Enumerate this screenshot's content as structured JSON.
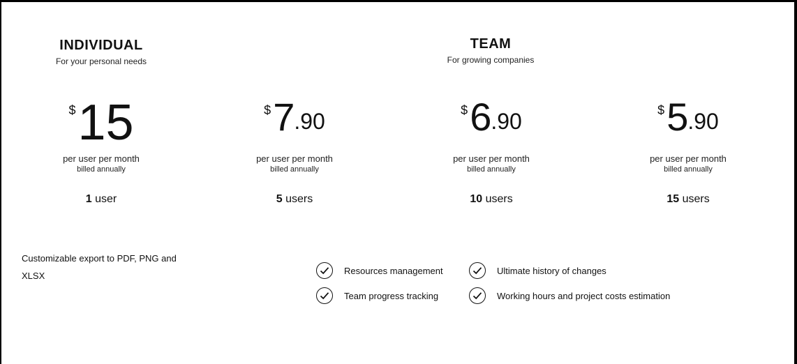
{
  "individual": {
    "title": "INDIVIDUAL",
    "subtitle": "For your personal needs"
  },
  "team": {
    "title": "TEAM",
    "subtitle": "For growing companies"
  },
  "plans": [
    {
      "currency": "$",
      "integer": "15",
      "decimal": "",
      "period": "per user per month",
      "billing": "billed annually",
      "users_count": "1",
      "users_label": "user"
    },
    {
      "currency": "$",
      "integer": "7",
      "decimal": ".90",
      "period": "per user per month",
      "billing": "billed annually",
      "users_count": "5",
      "users_label": "users"
    },
    {
      "currency": "$",
      "integer": "6",
      "decimal": ".90",
      "period": "per user per month",
      "billing": "billed annually",
      "users_count": "10",
      "users_label": "users"
    },
    {
      "currency": "$",
      "integer": "5",
      "decimal": ".90",
      "period": "per user per month",
      "billing": "billed annually",
      "users_count": "15",
      "users_label": "users"
    }
  ],
  "individual_features": {
    "text": "Customizable export to PDF, PNG and XLSX"
  },
  "team_features": [
    {
      "label": "Resources management",
      "icon": "check-circle-icon"
    },
    {
      "label": "Ultimate history of changes",
      "icon": "check-circle-icon"
    },
    {
      "label": "Team progress tracking",
      "icon": "check-circle-icon"
    },
    {
      "label": "Working hours and project costs estimation",
      "icon": "check-circle-icon"
    }
  ]
}
